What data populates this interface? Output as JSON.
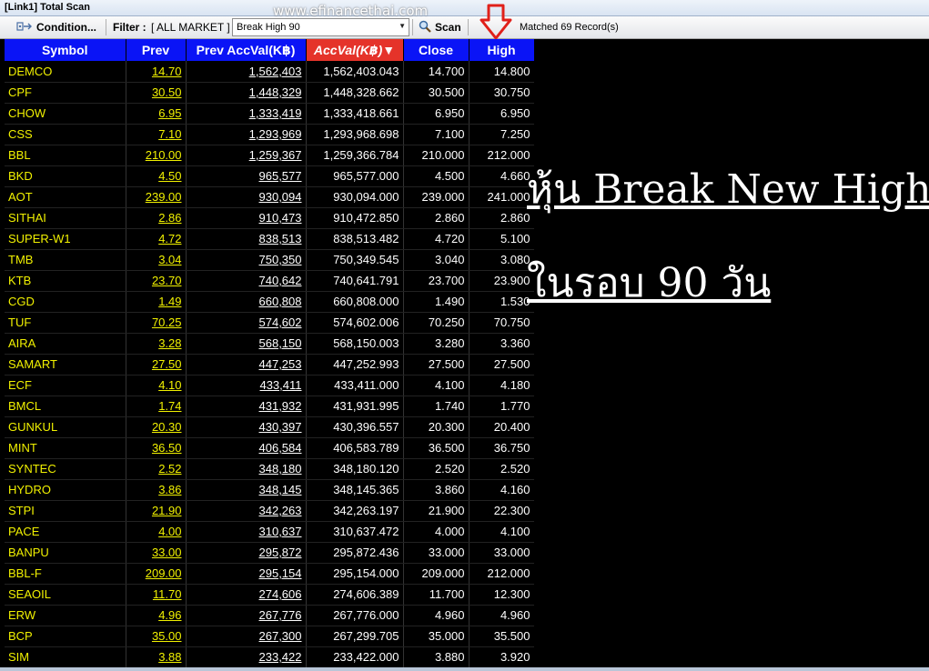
{
  "window": {
    "title": "[Link1] Total Scan"
  },
  "watermark": "www.efinancethai.com",
  "toolbar": {
    "condition_label": "Condition...",
    "filter_label": "Filter :",
    "market_filter": "[ ALL MARKET ]",
    "scan_type": "Break High 90",
    "scan_label": "Scan",
    "matched_text": "Matched 69 Record(s)"
  },
  "annotation": {
    "line1": "หุ้น Break New High",
    "line2": "ในรอบ 90 วัน"
  },
  "table": {
    "columns": [
      "Symbol",
      "Prev",
      "Prev AccVal(K฿)",
      "AccVal(K฿)",
      "Close",
      "High"
    ],
    "sort_indicator": "▼",
    "rows": [
      [
        "DEMCO",
        "14.70",
        "1,562,403",
        "1,562,403.043",
        "14.700",
        "14.800"
      ],
      [
        "CPF",
        "30.50",
        "1,448,329",
        "1,448,328.662",
        "30.500",
        "30.750"
      ],
      [
        "CHOW",
        "6.95",
        "1,333,419",
        "1,333,418.661",
        "6.950",
        "6.950"
      ],
      [
        "CSS",
        "7.10",
        "1,293,969",
        "1,293,968.698",
        "7.100",
        "7.250"
      ],
      [
        "BBL",
        "210.00",
        "1,259,367",
        "1,259,366.784",
        "210.000",
        "212.000"
      ],
      [
        "BKD",
        "4.50",
        "965,577",
        "965,577.000",
        "4.500",
        "4.660"
      ],
      [
        "AOT",
        "239.00",
        "930,094",
        "930,094.000",
        "239.000",
        "241.000"
      ],
      [
        "SITHAI",
        "2.86",
        "910,473",
        "910,472.850",
        "2.860",
        "2.860"
      ],
      [
        "SUPER-W1",
        "4.72",
        "838,513",
        "838,513.482",
        "4.720",
        "5.100"
      ],
      [
        "TMB",
        "3.04",
        "750,350",
        "750,349.545",
        "3.040",
        "3.080"
      ],
      [
        "KTB",
        "23.70",
        "740,642",
        "740,641.791",
        "23.700",
        "23.900"
      ],
      [
        "CGD",
        "1.49",
        "660,808",
        "660,808.000",
        "1.490",
        "1.530"
      ],
      [
        "TUF",
        "70.25",
        "574,602",
        "574,602.006",
        "70.250",
        "70.750"
      ],
      [
        "AIRA",
        "3.28",
        "568,150",
        "568,150.003",
        "3.280",
        "3.360"
      ],
      [
        "SAMART",
        "27.50",
        "447,253",
        "447,252.993",
        "27.500",
        "27.500"
      ],
      [
        "ECF",
        "4.10",
        "433,411",
        "433,411.000",
        "4.100",
        "4.180"
      ],
      [
        "BMCL",
        "1.74",
        "431,932",
        "431,931.995",
        "1.740",
        "1.770"
      ],
      [
        "GUNKUL",
        "20.30",
        "430,397",
        "430,396.557",
        "20.300",
        "20.400"
      ],
      [
        "MINT",
        "36.50",
        "406,584",
        "406,583.789",
        "36.500",
        "36.750"
      ],
      [
        "SYNTEC",
        "2.52",
        "348,180",
        "348,180.120",
        "2.520",
        "2.520"
      ],
      [
        "HYDRO",
        "3.86",
        "348,145",
        "348,145.365",
        "3.860",
        "4.160"
      ],
      [
        "STPI",
        "21.90",
        "342,263",
        "342,263.197",
        "21.900",
        "22.300"
      ],
      [
        "PACE",
        "4.00",
        "310,637",
        "310,637.472",
        "4.000",
        "4.100"
      ],
      [
        "BANPU",
        "33.00",
        "295,872",
        "295,872.436",
        "33.000",
        "33.000"
      ],
      [
        "BBL-F",
        "209.00",
        "295,154",
        "295,154.000",
        "209.000",
        "212.000"
      ],
      [
        "SEAOIL",
        "11.70",
        "274,606",
        "274,606.389",
        "11.700",
        "12.300"
      ],
      [
        "ERW",
        "4.96",
        "267,776",
        "267,776.000",
        "4.960",
        "4.960"
      ],
      [
        "BCP",
        "35.00",
        "267,300",
        "267,299.705",
        "35.000",
        "35.500"
      ],
      [
        "SIM",
        "3.88",
        "233,422",
        "233,422.000",
        "3.880",
        "3.920"
      ]
    ]
  },
  "colors": {
    "header_bg": "#0a14f6",
    "sorted_header_bg": "#e5332a",
    "symbol_text": "#f1f100",
    "value_text": "#ffffff",
    "background": "#000000"
  },
  "icons": [
    "condition-icon",
    "search-icon",
    "dropdown-arrow-icon",
    "red-down-arrow-icon"
  ]
}
